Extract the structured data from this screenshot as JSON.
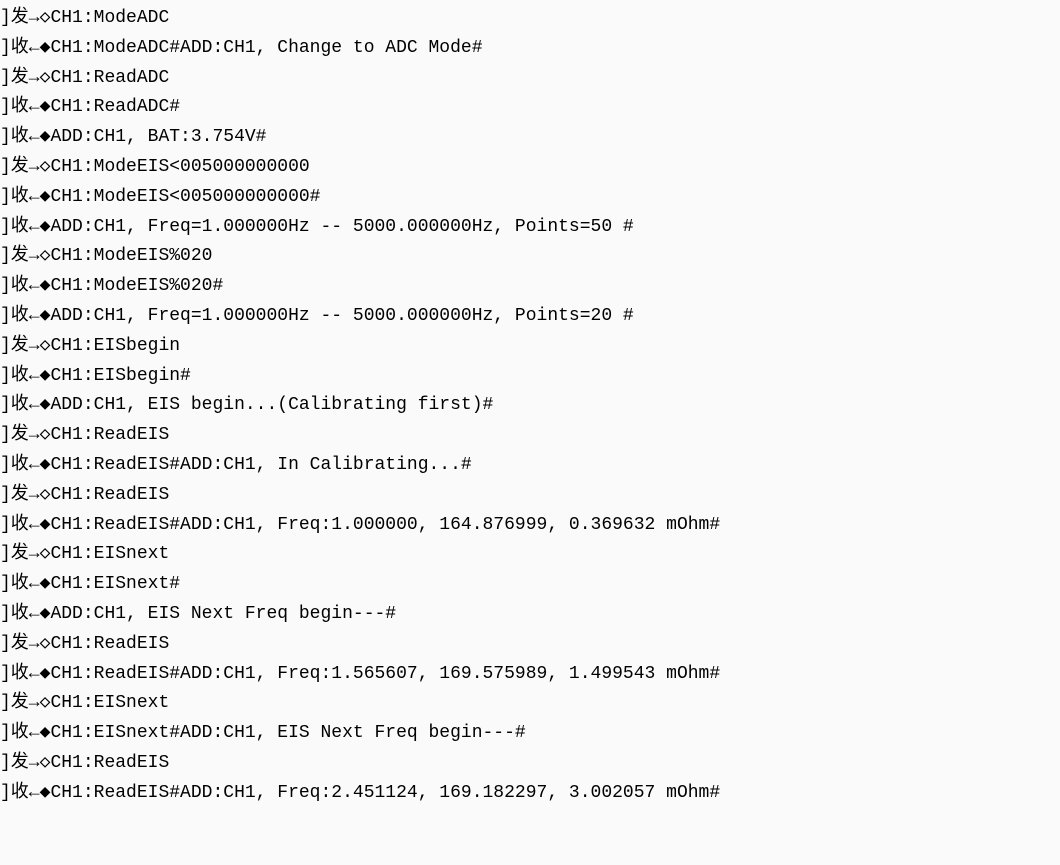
{
  "lines": [
    "]发→◇CH1:ModeADC",
    "]收←◆CH1:ModeADC#ADD:CH1, Change to ADC Mode#",
    "]发→◇CH1:ReadADC",
    "]收←◆CH1:ReadADC#",
    "]收←◆ADD:CH1, BAT:3.754V#",
    "]发→◇CH1:ModeEIS<005000000000",
    "]收←◆CH1:ModeEIS<005000000000#",
    "]收←◆ADD:CH1, Freq=1.000000Hz -- 5000.000000Hz, Points=50 #",
    "]发→◇CH1:ModeEIS%020",
    "]收←◆CH1:ModeEIS%020#",
    "]收←◆ADD:CH1, Freq=1.000000Hz -- 5000.000000Hz, Points=20 #",
    "]发→◇CH1:EISbegin",
    "]收←◆CH1:EISbegin#",
    "]收←◆ADD:CH1, EIS begin...(Calibrating first)#",
    "]发→◇CH1:ReadEIS",
    "]收←◆CH1:ReadEIS#ADD:CH1, In Calibrating...#",
    "]发→◇CH1:ReadEIS",
    "]收←◆CH1:ReadEIS#ADD:CH1, Freq:1.000000, 164.876999, 0.369632 mOhm#",
    "]发→◇CH1:EISnext",
    "]收←◆CH1:EISnext#",
    "]收←◆ADD:CH1, EIS Next Freq begin---#",
    "]发→◇CH1:ReadEIS",
    "]收←◆CH1:ReadEIS#ADD:CH1, Freq:1.565607, 169.575989, 1.499543 mOhm#",
    "]发→◇CH1:EISnext",
    "]收←◆CH1:EISnext#ADD:CH1, EIS Next Freq begin---#",
    "]发→◇CH1:ReadEIS",
    "]收←◆CH1:ReadEIS#ADD:CH1, Freq:2.451124, 169.182297, 3.002057 mOhm#"
  ]
}
